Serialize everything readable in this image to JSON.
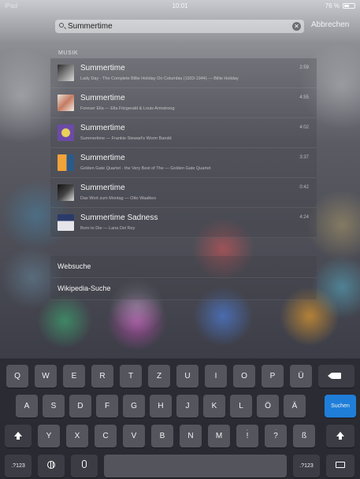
{
  "status": {
    "carrier": "iPad",
    "time": "10:01",
    "battery": "76 %"
  },
  "search": {
    "value": "Summertime",
    "cancel_label": "Abbrechen"
  },
  "music": {
    "section_label": "MUSIK",
    "results": [
      {
        "title": "Summertime",
        "subtitle": "Lady Day - The Complete Billie Holiday On Columbia (1933-1944)  —  Billie Holiday",
        "duration": "2:59"
      },
      {
        "title": "Summertime",
        "subtitle": "Forever Ella  —  Ella Fitzgerald & Louis Armstrong",
        "duration": "4:55"
      },
      {
        "title": "Summertime",
        "subtitle": "Summertime  —  Frankie Stewart's Worm Bandd",
        "duration": "4:02"
      },
      {
        "title": "Summertime",
        "subtitle": "Golden Gate Quartet - the Very Best of The  —  Golden Gate Quartet",
        "duration": "3:37"
      },
      {
        "title": "Summertime",
        "subtitle": "Das Wort zum Montag  —  Otto Waalkes",
        "duration": "0:42"
      },
      {
        "title": "Summertime Sadness",
        "subtitle": "Born to Die  —  Lana Del Rey",
        "duration": "4:24"
      }
    ]
  },
  "web": {
    "items": [
      "Websuche",
      "Wikipedia-Suche"
    ]
  },
  "keyboard": {
    "row1": [
      "Q",
      "W",
      "E",
      "R",
      "T",
      "Z",
      "U",
      "I",
      "O",
      "P",
      "Ü"
    ],
    "row2": [
      "A",
      "S",
      "D",
      "F",
      "G",
      "H",
      "J",
      "K",
      "L",
      "Ö",
      "Ä"
    ],
    "row3": [
      "Y",
      "X",
      "C",
      "V",
      "B",
      "N",
      "M",
      "!",
      "?",
      "ß"
    ],
    "row3_sup": [
      "",
      "",
      "",
      "",
      "",
      "",
      "",
      ",",
      ".",
      ""
    ],
    "search_key": "Suchen",
    "numbers_key": ".?123"
  },
  "colors": {
    "accent": "#1f7ed8"
  }
}
